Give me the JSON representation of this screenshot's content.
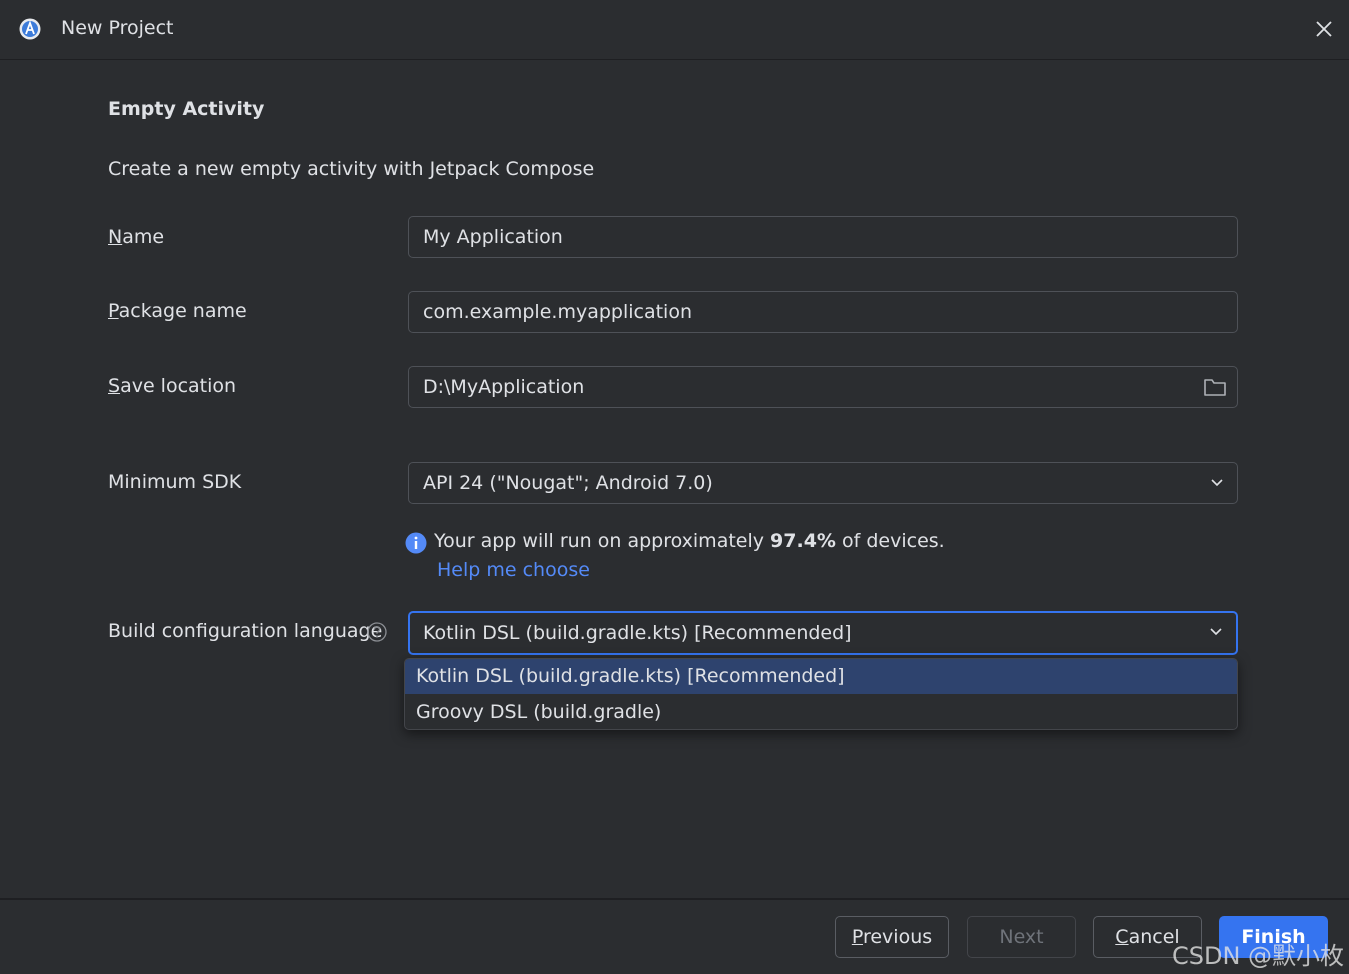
{
  "window": {
    "title": "New Project",
    "logo_icon": "android-studio-icon",
    "close_icon": "close-icon"
  },
  "page": {
    "heading": "Empty Activity",
    "description": "Create a new empty activity with Jetpack Compose"
  },
  "form": {
    "name": {
      "label_first": "N",
      "label_rest": "ame",
      "value": "My Application"
    },
    "package": {
      "label_first": "P",
      "label_rest": "ackage name",
      "value": "com.example.myapplication"
    },
    "save_location": {
      "label_first": "S",
      "label_rest": "ave location",
      "value": "D:\\MyApplication",
      "icon": "folder-icon"
    },
    "min_sdk": {
      "label": "Minimum SDK",
      "value": "API 24 (\"Nougat\"; Android 7.0)"
    },
    "sdk_info": {
      "prefix": "Your app will run on approximately ",
      "percent": "97.4%",
      "suffix": " of devices.",
      "link": "Help me choose"
    },
    "build_language": {
      "label": "Build configuration language",
      "value": "Kotlin DSL (build.gradle.kts) [Recommended]",
      "options": [
        "Kotlin DSL (build.gradle.kts) [Recommended]",
        "Groovy DSL (build.gradle)"
      ],
      "selected_index": 0
    }
  },
  "buttons": {
    "previous_first": "P",
    "previous_rest": "revious",
    "next": "Next",
    "cancel_first": "C",
    "cancel_rest": "ancel",
    "finish": "Finish"
  },
  "watermark": "CSDN @默小枚",
  "colors": {
    "background": "#2b2d30",
    "accent": "#3574f0",
    "link": "#548af7",
    "selection": "#2e436e"
  }
}
